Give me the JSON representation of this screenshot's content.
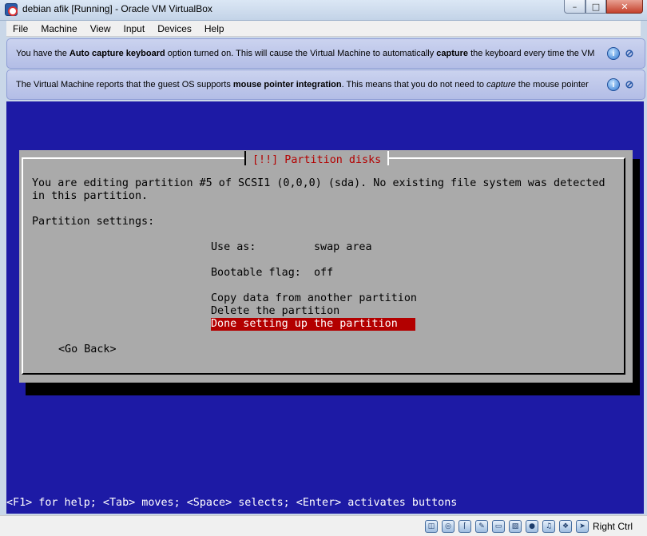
{
  "window": {
    "title": "debian afik [Running] - Oracle VM VirtualBox",
    "minimize_glyph": "–",
    "maximize_glyph": "□",
    "close_glyph": "✕"
  },
  "menubar": {
    "items": [
      "File",
      "Machine",
      "View",
      "Input",
      "Devices",
      "Help"
    ]
  },
  "notices": [
    {
      "pre": "You have the ",
      "bold1": "Auto capture keyboard",
      "mid": " option turned on. This will cause the Virtual Machine to automatically ",
      "bold2": "capture",
      "post": " the keyboard every time the VM"
    },
    {
      "pre": "The Virtual Machine reports that the guest OS supports ",
      "bold1": "mouse pointer integration",
      "mid": ". This means that you do not need to ",
      "italic": "capture",
      "post": " the mouse pointer"
    }
  ],
  "dialog": {
    "title": "[!!] Partition disks",
    "description_line1": "You are editing partition #5 of SCSI1 (0,0,0) (sda). No existing file system was detected",
    "description_line2": "in this partition.",
    "settings_heading": "Partition settings:",
    "options": {
      "use_as": "Use as:         swap area",
      "bootable": "Bootable flag:  off",
      "copy": "Copy data from another partition",
      "delete": "Delete the partition",
      "done": "Done setting up the partition"
    },
    "selected_option": "done",
    "go_back": "<Go Back>"
  },
  "help_line": "<F1> for help; <Tab> moves; <Space> selects; <Enter> activates buttons",
  "statusbar": {
    "host_key": "Right Ctrl",
    "icons": [
      "hard-disk-icon",
      "optical-drive-icon",
      "usb-icon",
      "shared-folders-icon",
      "display-icon",
      "network-icon",
      "video-capture-icon",
      "audio-icon",
      "keyboard-capture-icon",
      "mouse-integration-icon"
    ]
  },
  "colors": {
    "vm_background": "#1d1aa5",
    "dialog_background": "#aaaaaa",
    "dialog_title": "#b30000",
    "selected_bg": "#b30000",
    "selected_fg": "#ffffff"
  }
}
